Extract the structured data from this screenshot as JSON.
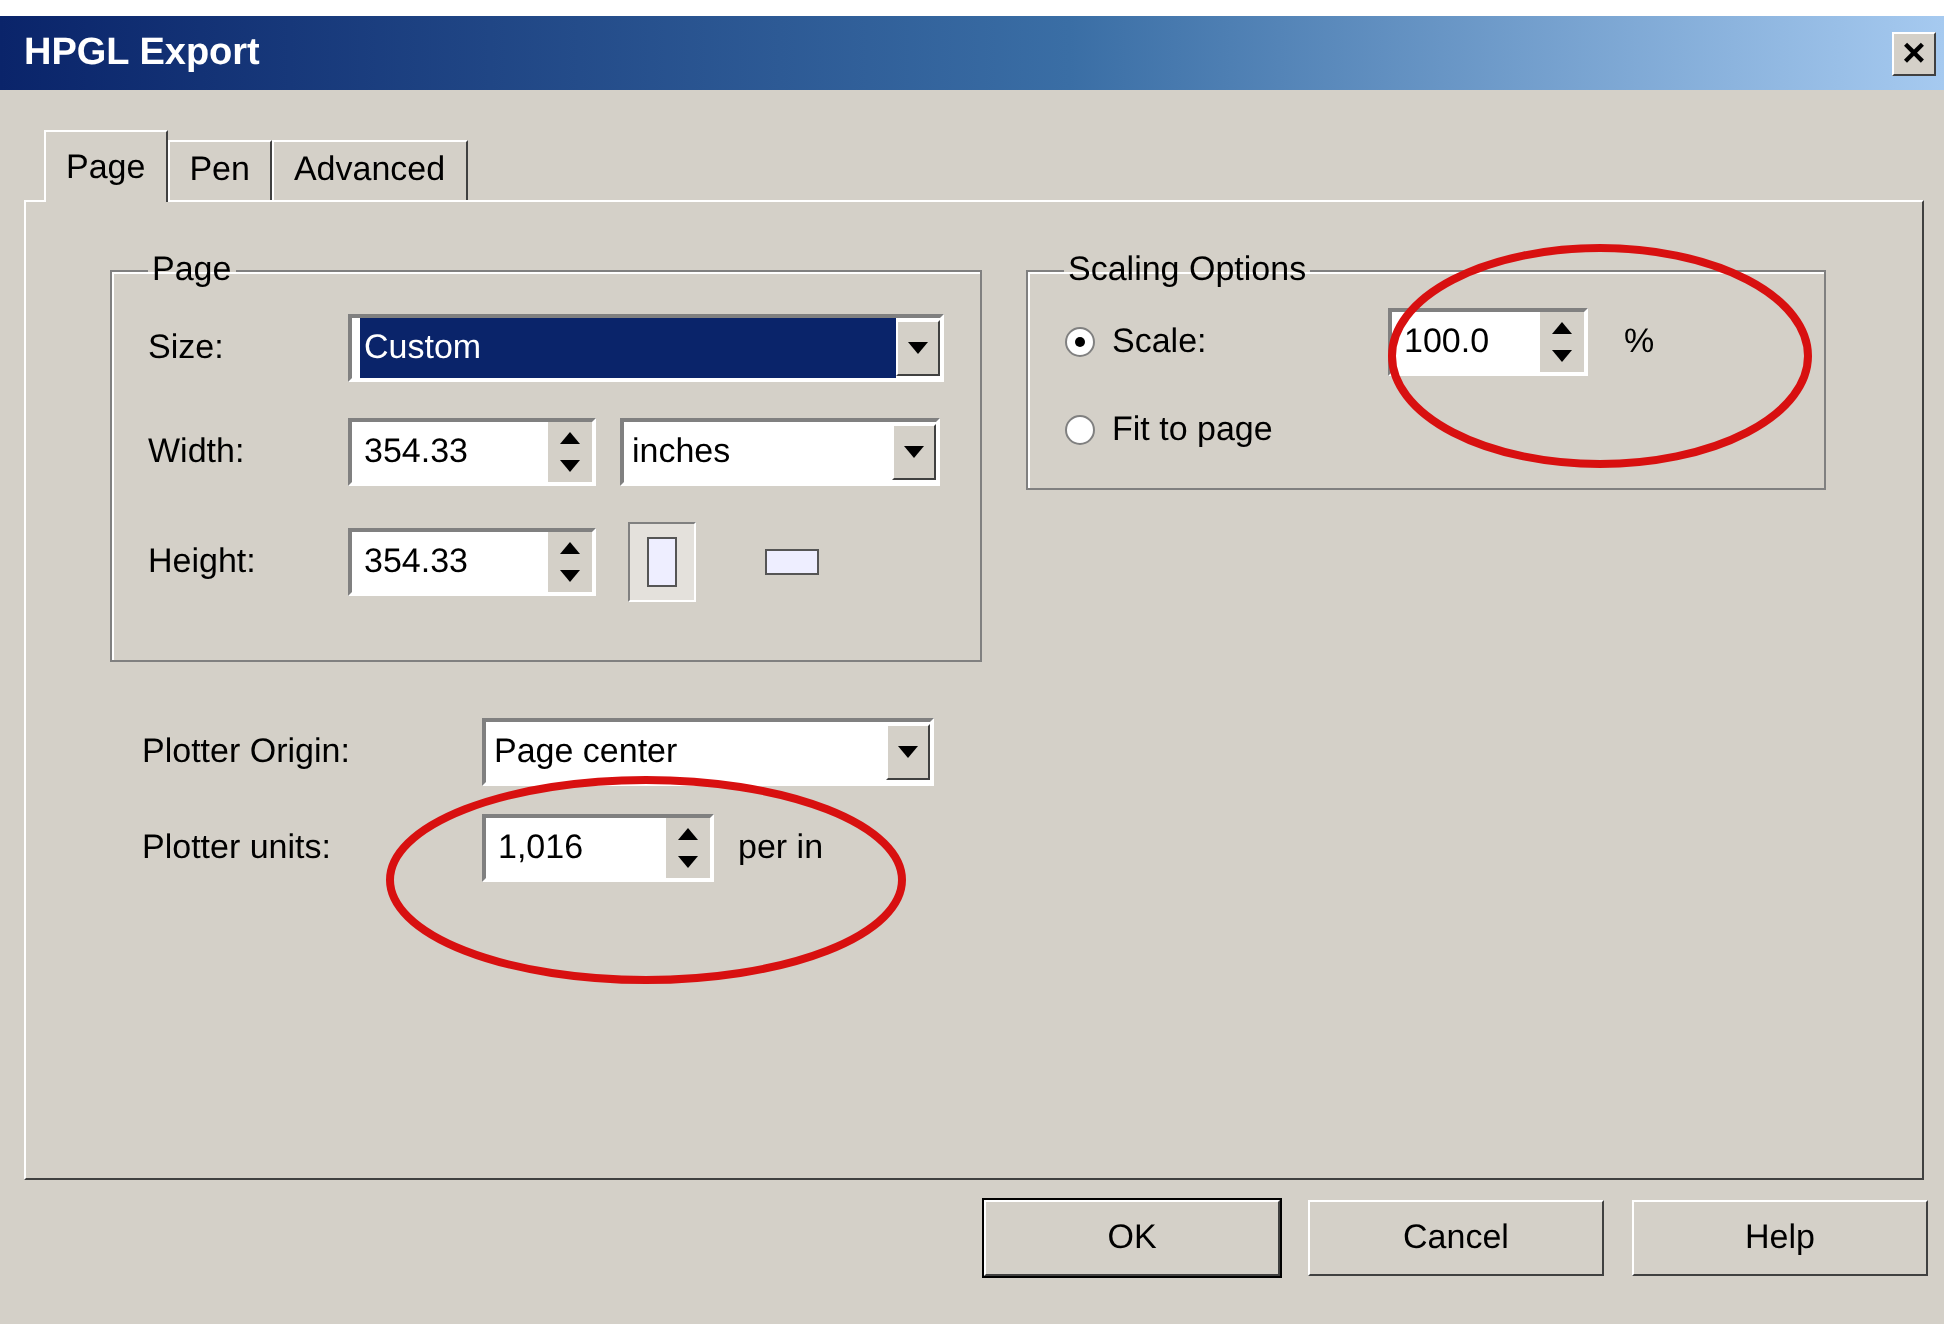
{
  "window": {
    "title": "HPGL Export",
    "close": "×"
  },
  "tabs": [
    {
      "label": "Page",
      "selected": true
    },
    {
      "label": "Pen",
      "selected": false
    },
    {
      "label": "Advanced",
      "selected": false
    }
  ],
  "page_group": {
    "title": "Page",
    "size": {
      "label": "Size:",
      "value": "Custom"
    },
    "width": {
      "label": "Width:",
      "value": "354.33",
      "unit": "inches"
    },
    "height": {
      "label": "Height:",
      "value": "354.33"
    },
    "orientations": [
      {
        "kind": "portrait",
        "selected": true
      },
      {
        "kind": "landscape",
        "selected": false
      }
    ]
  },
  "scaling": {
    "title": "Scaling Options",
    "options": [
      {
        "label": "Scale:",
        "selected": true,
        "value": "100.0",
        "unit": "%"
      },
      {
        "label": "Fit to page",
        "selected": false
      }
    ]
  },
  "plotter_origin": {
    "label": "Plotter Origin:",
    "value": "Page center"
  },
  "plotter_units": {
    "label": "Plotter units:",
    "value": "1,016",
    "unit": "per in"
  },
  "buttons": [
    {
      "label": "OK",
      "default": true
    },
    {
      "label": "Cancel",
      "default": false
    },
    {
      "label": "Help",
      "default": false
    }
  ]
}
